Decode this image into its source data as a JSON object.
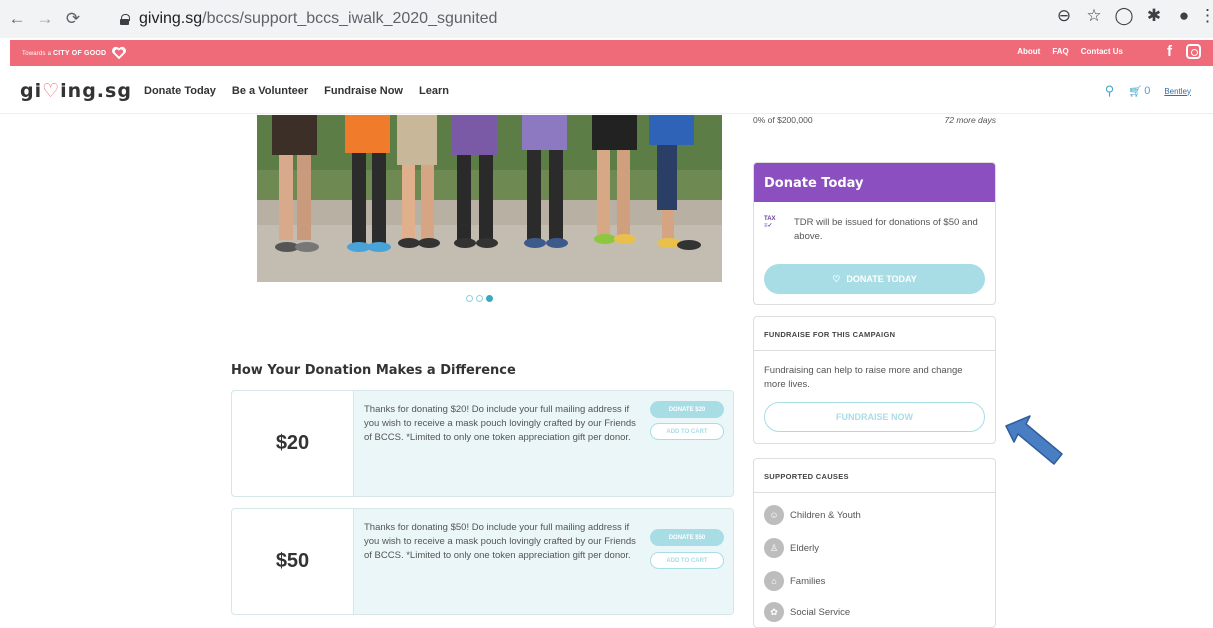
{
  "browser": {
    "url_host": "giving.sg",
    "url_path": "/bccs/support_bccs_iwalk_2020_sgunited"
  },
  "topbar": {
    "towards_prefix": "Towards a",
    "towards_brand": "CITY OF GOOD",
    "links": [
      "About",
      "FAQ",
      "Contact Us"
    ]
  },
  "nav": {
    "logo_pre": "gi",
    "logo_heart": "♡",
    "logo_post": "ing.sg",
    "menu": [
      "Donate Today",
      "Be a Volunteer",
      "Fundraise Now",
      "Learn"
    ],
    "cart_count": "0",
    "user_name": "Bentley"
  },
  "carousel": {
    "slides": 3,
    "active_index": 2
  },
  "progress": {
    "raised": "0% of $200,000",
    "days_left": "72 more days"
  },
  "donation_section": {
    "title": "How Your Donation Makes a Difference",
    "cards": [
      {
        "amount": "$20",
        "description": "Thanks for donating $20! Do include your full mailing address if you wish to receive a mask pouch lovingly crafted by our Friends of BCCS. *Limited to only one token appreciation gift per donor.",
        "donate_label": "DONATE $20",
        "cart_label": "ADD TO CART"
      },
      {
        "amount": "$50",
        "description": "Thanks for donating $50! Do include your full mailing address if you wish to receive a mask pouch lovingly crafted by our Friends of BCCS. *Limited to only one token appreciation gift per donor.",
        "donate_label": "DONATE $50",
        "cart_label": "ADD TO CART"
      }
    ]
  },
  "donate_panel": {
    "title": "Donate Today",
    "tax_icon_text": "TAX",
    "tdr_text": "TDR will be issued for donations of $50 and above.",
    "button": "DONATE TODAY"
  },
  "fundraise_panel": {
    "title": "FUNDRAISE FOR THIS CAMPAIGN",
    "text": "Fundraising can help to raise more and change more lives.",
    "button": "FUNDRAISE NOW"
  },
  "causes_panel": {
    "title": "SUPPORTED CAUSES",
    "causes": [
      "Children & Youth",
      "Elderly",
      "Families",
      "Social Service"
    ]
  },
  "colors": {
    "brand_pink": "#f06b7a",
    "donate_purple": "#8c4fc0",
    "accent_teal": "#a9dde6",
    "annotation_arrow": "#4a7ec2"
  }
}
